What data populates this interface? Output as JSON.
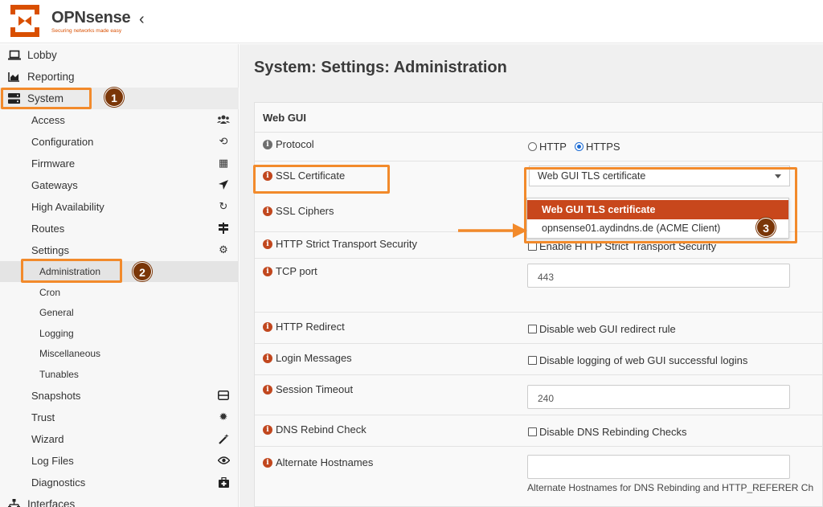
{
  "brand": {
    "name": "OPNsense",
    "tagline": "Securing networks made easy",
    "color": "#d94f00"
  },
  "header": {
    "collapse_icon": "chevron-left-icon",
    "collapse_glyph": "‹"
  },
  "sidebar": {
    "lobby": "Lobby",
    "reporting": "Reporting",
    "system": "System",
    "interfaces": "Interfaces",
    "system_items": [
      {
        "label": "Access",
        "icon": "users-icon",
        "glyph": "👥"
      },
      {
        "label": "Configuration",
        "icon": "history-icon",
        "glyph": "⟲"
      },
      {
        "label": "Firmware",
        "icon": "building-icon",
        "glyph": "▦"
      },
      {
        "label": "Gateways",
        "icon": "location-arrow-icon",
        "glyph": "➤"
      },
      {
        "label": "High Availability",
        "icon": "refresh-icon",
        "glyph": "↻"
      },
      {
        "label": "Routes",
        "icon": "signpost-icon",
        "glyph": "⇌"
      },
      {
        "label": "Settings",
        "icon": "cogs-icon",
        "glyph": "⚙"
      }
    ],
    "settings_items": [
      "Administration",
      "Cron",
      "General",
      "Logging",
      "Miscellaneous",
      "Tunables"
    ],
    "system_items_after": [
      {
        "label": "Snapshots",
        "icon": "hdd-icon",
        "glyph": "⊟"
      },
      {
        "label": "Trust",
        "icon": "certificate-icon",
        "glyph": "✹"
      },
      {
        "label": "Wizard",
        "icon": "magic-icon",
        "glyph": "✧"
      },
      {
        "label": "Log Files",
        "icon": "eye-icon",
        "glyph": "◉"
      },
      {
        "label": "Diagnostics",
        "icon": "medkit-icon",
        "glyph": "▣"
      }
    ]
  },
  "main": {
    "title": "System: Settings: Administration",
    "section": "Web GUI",
    "protocol": {
      "label": "Protocol",
      "options": [
        "HTTP",
        "HTTPS"
      ],
      "selected": "HTTPS"
    },
    "ssl_certificate": {
      "label": "SSL Certificate",
      "selected": "Web GUI TLS certificate",
      "options": [
        "Web GUI TLS certificate",
        "opnsense01.aydindns.de (ACME Client)"
      ]
    },
    "ssl_ciphers": {
      "label": "SSL Ciphers"
    },
    "hsts": {
      "label": "HTTP Strict Transport Security",
      "checkbox": "Enable HTTP Strict Transport Security"
    },
    "tcp_port": {
      "label": "TCP port",
      "placeholder": "443"
    },
    "http_redirect": {
      "label": "HTTP Redirect",
      "checkbox": "Disable web GUI redirect rule"
    },
    "login_messages": {
      "label": "Login Messages",
      "checkbox": "Disable logging of web GUI successful logins"
    },
    "session_timeout": {
      "label": "Session Timeout",
      "placeholder": "240"
    },
    "dns_rebind": {
      "label": "DNS Rebind Check",
      "checkbox": "Disable DNS Rebinding Checks"
    },
    "alt_hostnames": {
      "label": "Alternate Hostnames",
      "help": "Alternate Hostnames for DNS Rebinding and HTTP_REFERER Ch"
    }
  },
  "annotations": {
    "badge_1": "1",
    "badge_2": "2",
    "badge_3": "3",
    "highlight_color": "#f28a2b"
  }
}
